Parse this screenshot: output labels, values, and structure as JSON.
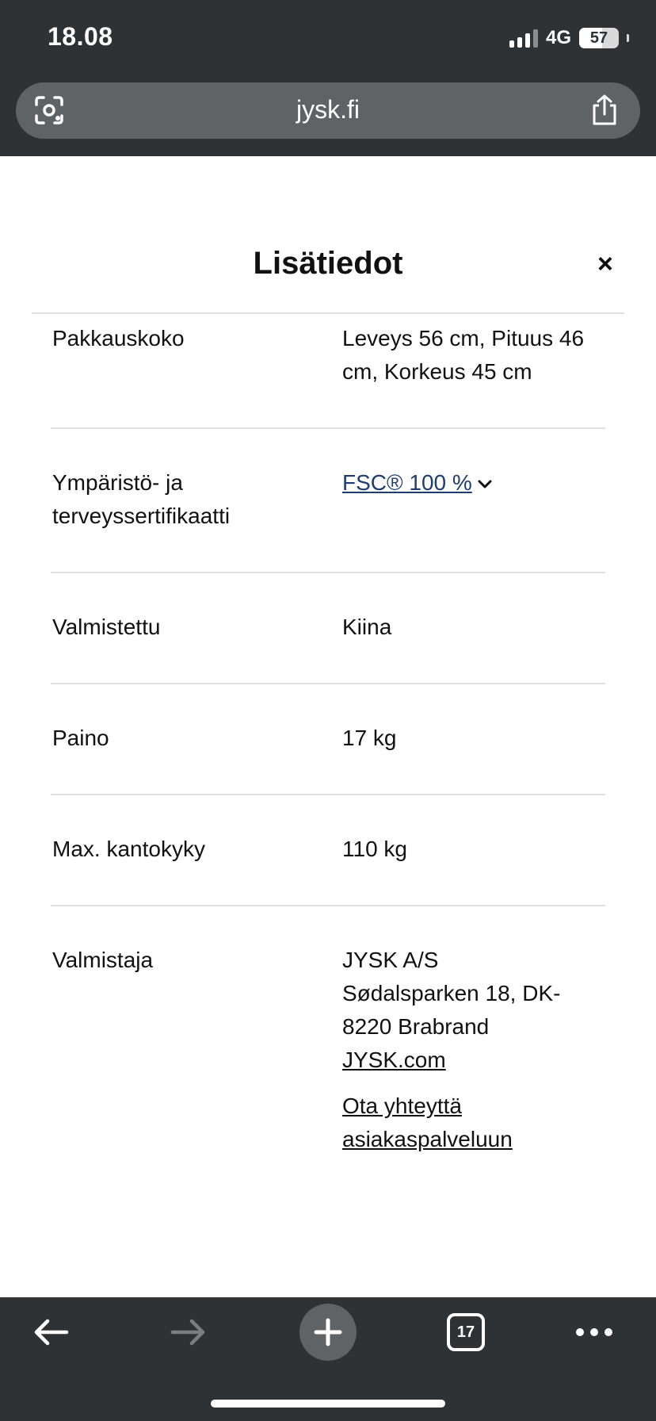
{
  "status_bar": {
    "time": "18.08",
    "network": "4G",
    "battery": "57"
  },
  "browser": {
    "url": "jysk.fi",
    "tabs_count": "17"
  },
  "modal": {
    "title": "Lisätiedot",
    "close_label": "×",
    "rows": [
      {
        "label": "Pakkauskoko",
        "value": "Leveys 56 cm, Pituus 46 cm, Korkeus 45 cm"
      },
      {
        "label": "Ympäristö- ja terveyssertifikaatti",
        "value": "FSC® 100 %"
      },
      {
        "label": "Valmistettu",
        "value": "Kiina"
      },
      {
        "label": "Paino",
        "value": "17 kg"
      },
      {
        "label": "Max. kantokyky",
        "value": "110 kg"
      },
      {
        "label": "Valmistaja",
        "company": "JYSK A/S",
        "address": "Sødalsparken 18, DK-8220 Brabrand",
        "website": "JYSK.com",
        "contact_link": "Ota yhteyttä asiakaspalveluun"
      }
    ]
  }
}
